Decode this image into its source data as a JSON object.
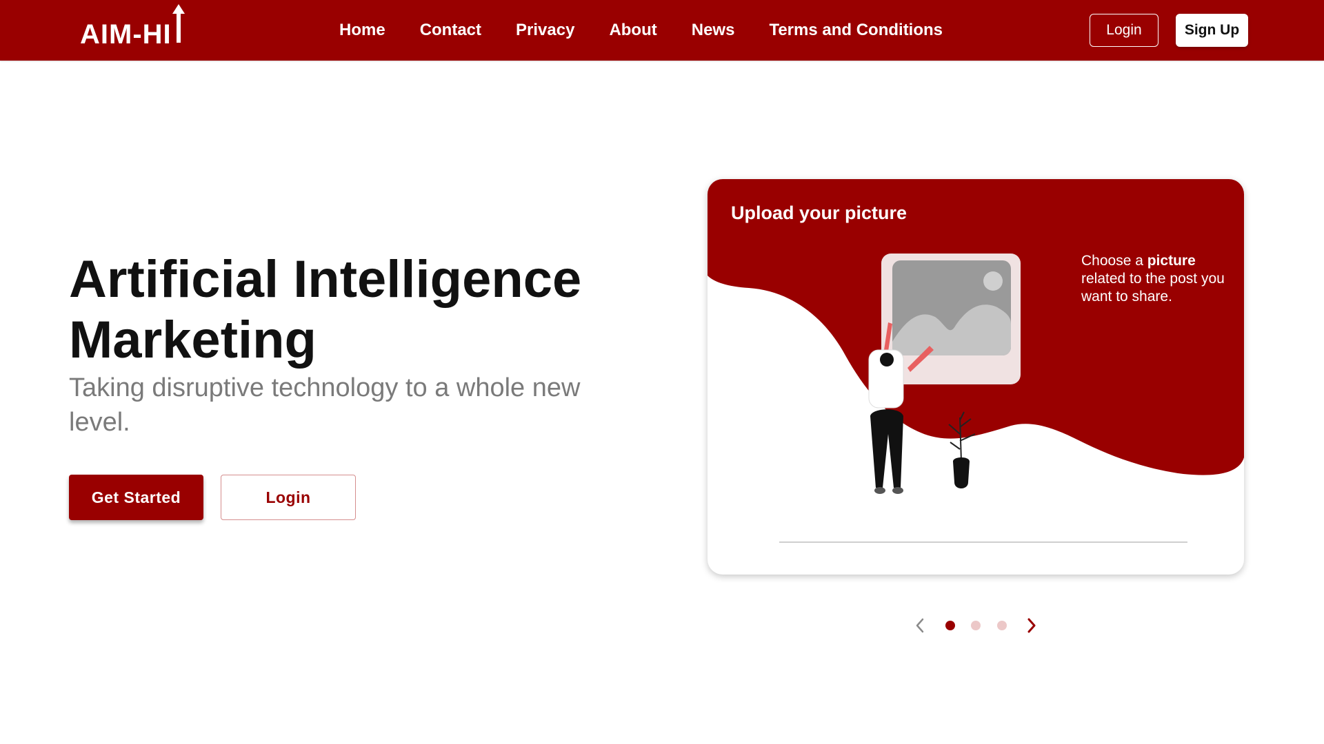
{
  "brand": {
    "logo_text": "AIM-HI"
  },
  "nav": {
    "links": [
      "Home",
      "Contact",
      "Privacy",
      "About",
      "News",
      "Terms and Conditions"
    ],
    "login_label": "Login",
    "signup_label": "Sign Up"
  },
  "hero": {
    "title_line1": "Artificial Intelligence",
    "title_line2": "Marketing",
    "subtitle": "Taking disruptive technology to a whole new level.",
    "get_started_label": "Get Started",
    "login_label": "Login"
  },
  "card": {
    "title": "Upload your picture",
    "desc_prefix": "Choose a ",
    "desc_bold": "picture",
    "desc_suffix": " related to the post you want to share."
  },
  "carousel": {
    "active_index": 0,
    "slide_count": 3
  },
  "colors": {
    "brand": "#990000",
    "accent_pink": "#e86060",
    "dot_inactive": "#ecc8c8"
  },
  "icons": {
    "prev": "chevron-left-icon",
    "next": "chevron-right-icon"
  }
}
